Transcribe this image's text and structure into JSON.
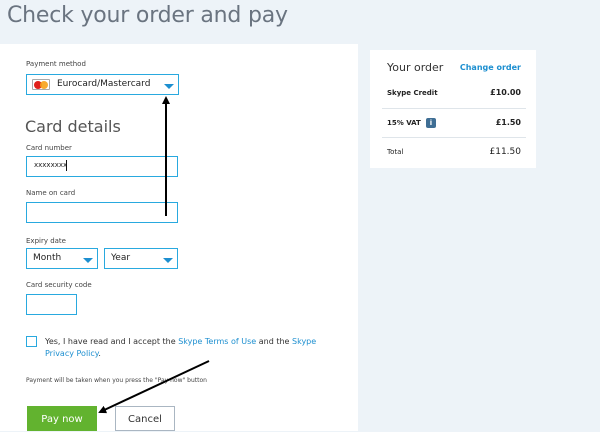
{
  "page": {
    "title": "Check your order and pay"
  },
  "payment": {
    "method_label": "Payment method",
    "method_value": "Eurocard/Mastercard",
    "card_details_heading": "Card details",
    "card_number_label": "Card number",
    "card_number_value": "xxxxxxxx",
    "name_label": "Name on card",
    "name_value": "",
    "expiry_label": "Expiry date",
    "month_value": "Month",
    "year_value": "Year",
    "security_label": "Card security code",
    "security_value": "",
    "terms_prefix": "Yes, I have read and I accept the ",
    "terms_link1": "Skype Terms of Use",
    "terms_mid": " and the ",
    "terms_link2": "Skype Privacy Policy",
    "terms_suffix": ".",
    "note": "Payment will be taken when you press the \"Pay now\" button",
    "pay_label": "Pay now",
    "cancel_label": "Cancel"
  },
  "order": {
    "title": "Your order",
    "change_label": "Change order",
    "rows": [
      {
        "label": "Skype Credit",
        "value": "£10.00"
      },
      {
        "label": "15% VAT",
        "value": "£1.50"
      }
    ],
    "info_icon": "i",
    "total_label": "Total",
    "total_value": "£11.50"
  },
  "colors": {
    "accent": "#29a9df",
    "link": "#1d8fd0",
    "pay_button": "#62b32f",
    "background": "#edf3f8"
  },
  "icons": [
    "mastercard-icon",
    "chevron-down-icon",
    "info-icon",
    "annotation-arrow"
  ]
}
